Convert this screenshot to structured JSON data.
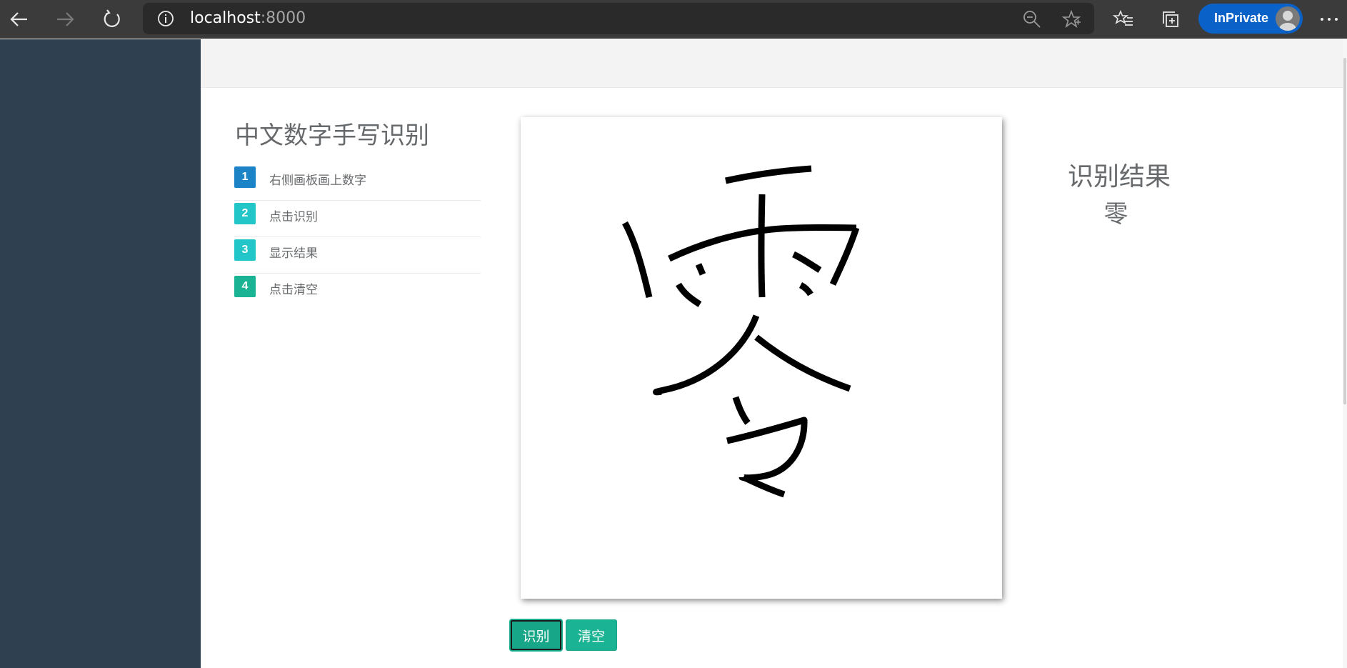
{
  "browser": {
    "url_host": "localhost",
    "url_port": ":8000",
    "inprivate_label": "InPrivate"
  },
  "page": {
    "title": "中文数字手写识别",
    "steps": [
      {
        "number": "1",
        "label": "右侧画板画上数字",
        "color": "#1c84c6"
      },
      {
        "number": "2",
        "label": "点击识别",
        "color": "#23c6c8"
      },
      {
        "number": "3",
        "label": "显示结果",
        "color": "#23c6c8"
      },
      {
        "number": "4",
        "label": "点击清空",
        "color": "#1ab394"
      }
    ],
    "buttons": {
      "recognize_label": "识别",
      "clear_label": "清空"
    },
    "result": {
      "title": "识别结果",
      "value": "零"
    }
  },
  "colors": {
    "sidebar": "#2f4050",
    "accent": "#1ab394",
    "text": "#676a6c"
  }
}
